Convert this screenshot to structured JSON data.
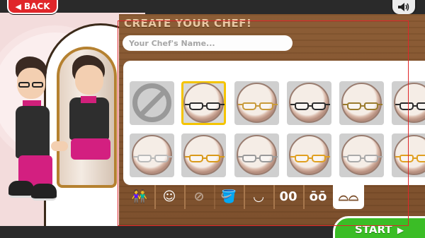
{
  "header": {
    "back_label": "BACK",
    "back_icon": "left-arrow",
    "sound_icon": "speaker"
  },
  "editor": {
    "title": "CREATE YOUR CHEF!",
    "name_placeholder": "Your Chef's Name...",
    "name_value": ""
  },
  "glasses_grid": {
    "selected_index": 1,
    "rows": [
      [
        {
          "style": "none",
          "frame_color": ""
        },
        {
          "style": "rect",
          "frame_color": "#2b2b2b"
        },
        {
          "style": "rect",
          "frame_color": "#c89a3a"
        },
        {
          "style": "rect",
          "frame_color": "#2b2b2b"
        },
        {
          "style": "rect",
          "frame_color": "#9a7b2e"
        },
        {
          "style": "rect",
          "frame_color": "#2b2b2b"
        }
      ],
      [
        {
          "style": "rect",
          "frame_color": "#bbbbbb"
        },
        {
          "style": "rect",
          "frame_color": "#d99a1a"
        },
        {
          "style": "rect",
          "frame_color": "#9a9a9a"
        },
        {
          "style": "rect",
          "frame_color": "#e0a020"
        },
        {
          "style": "rect",
          "frame_color": "#aaaaaa"
        },
        {
          "style": "rect",
          "frame_color": "#e0a020"
        }
      ]
    ]
  },
  "tabs": [
    {
      "id": "body",
      "icon": "people-icon",
      "glyph": "👫",
      "state": "normal"
    },
    {
      "id": "hair",
      "icon": "hair-icon",
      "glyph": "☺",
      "state": "normal"
    },
    {
      "id": "hat",
      "icon": "hat-icon",
      "glyph": "⊘",
      "state": "disabled"
    },
    {
      "id": "skin",
      "icon": "paint-bucket-icon",
      "glyph": "🪣",
      "state": "normal"
    },
    {
      "id": "mouth",
      "icon": "mouth-icon",
      "glyph": "◡",
      "state": "normal"
    },
    {
      "id": "eyes",
      "icon": "eyes-icon",
      "glyph": "00",
      "state": "normal"
    },
    {
      "id": "eyebrows",
      "icon": "eyebrows-icon",
      "glyph": "ōō",
      "state": "normal"
    },
    {
      "id": "glasses",
      "icon": "glasses-icon",
      "glyph": "⌓⌓",
      "state": "active"
    }
  ],
  "footer": {
    "start_label": "START",
    "start_icon": "right-arrow"
  },
  "colors": {
    "wood": "#7a4d29",
    "back_red": "#e0262a",
    "start_green": "#3bbd26",
    "selected_outline": "#f4c400",
    "chef_shirt": "#2e2e2e",
    "chef_accent": "#d1207b"
  }
}
